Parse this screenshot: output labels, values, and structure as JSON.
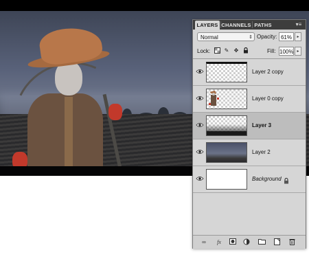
{
  "panel": {
    "tabs": [
      {
        "label": "LAYERS",
        "active": true
      },
      {
        "label": "CHANNELS",
        "active": false
      },
      {
        "label": "PATHS",
        "active": false
      }
    ],
    "menu_icon": "panel-menu-icon",
    "blend_mode": "Normal",
    "opacity_label": "Opacity:",
    "opacity_value": "61%",
    "lock_label": "Lock:",
    "lock_icons": [
      "lock-transparent-pixels-icon",
      "lock-image-pixels-icon",
      "lock-position-icon",
      "lock-all-icon"
    ],
    "fill_label": "Fill:",
    "fill_value": "100%",
    "layers": [
      {
        "name": "Layer 2 copy",
        "visible": true,
        "selected": false
      },
      {
        "name": "Layer 0 copy",
        "visible": true,
        "selected": false
      },
      {
        "name": "Layer 3",
        "visible": true,
        "selected": true
      },
      {
        "name": "Layer 2",
        "visible": true,
        "selected": false
      },
      {
        "name": "Background",
        "visible": true,
        "selected": false,
        "locked": true
      }
    ],
    "footer_icons": [
      "link-layers-icon",
      "add-layer-style-icon",
      "add-mask-icon",
      "adjustment-layer-icon",
      "new-group-icon",
      "new-layer-icon",
      "delete-layer-icon"
    ]
  },
  "colors": {
    "panel_bg": "#d6d6d6",
    "tabbar_bg": "#3d3d3d",
    "selected_row": "#bdbdbd",
    "glove_red": "#c2392b",
    "hat_orange": "#b8774a"
  }
}
